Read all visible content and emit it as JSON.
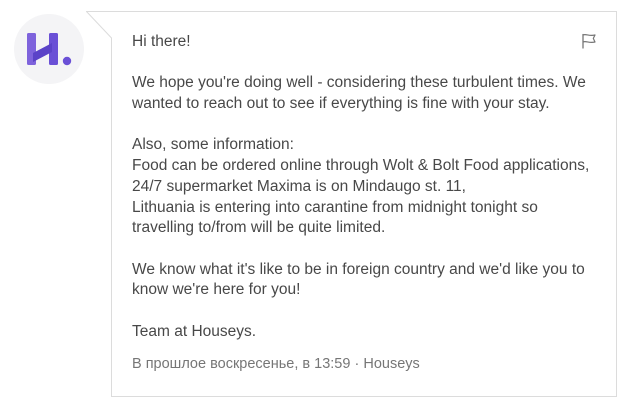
{
  "sender": {
    "avatar_icon": "houseys-logo-icon",
    "brand_color": "#7b5fd9",
    "accent_color": "#5b48c9"
  },
  "message": {
    "paragraphs": [
      "Hi there!",
      "We hope you're doing well - considering these turbulent times. We wanted to reach out to see if everything is fine with your stay.",
      "Also, some information:\nFood can be ordered online through Wolt & Bolt Food applications,\n24/7 supermarket Maxima is on Mindaugo st. 11,\nLithuania is entering into carantine from midnight tonight so travelling to/from will be quite limited.",
      "We know what it's like to be in foreign country and we'd like you to know we're here for you!",
      "Team at Houseys."
    ],
    "report_icon": "flag-icon",
    "timestamp": "В прошлое воскресенье, в 13:59",
    "separator": "·",
    "sender_name": "Houseys"
  },
  "colors": {
    "bubble_border": "#dcdcdc",
    "text": "#484848",
    "meta_text": "#767676"
  }
}
